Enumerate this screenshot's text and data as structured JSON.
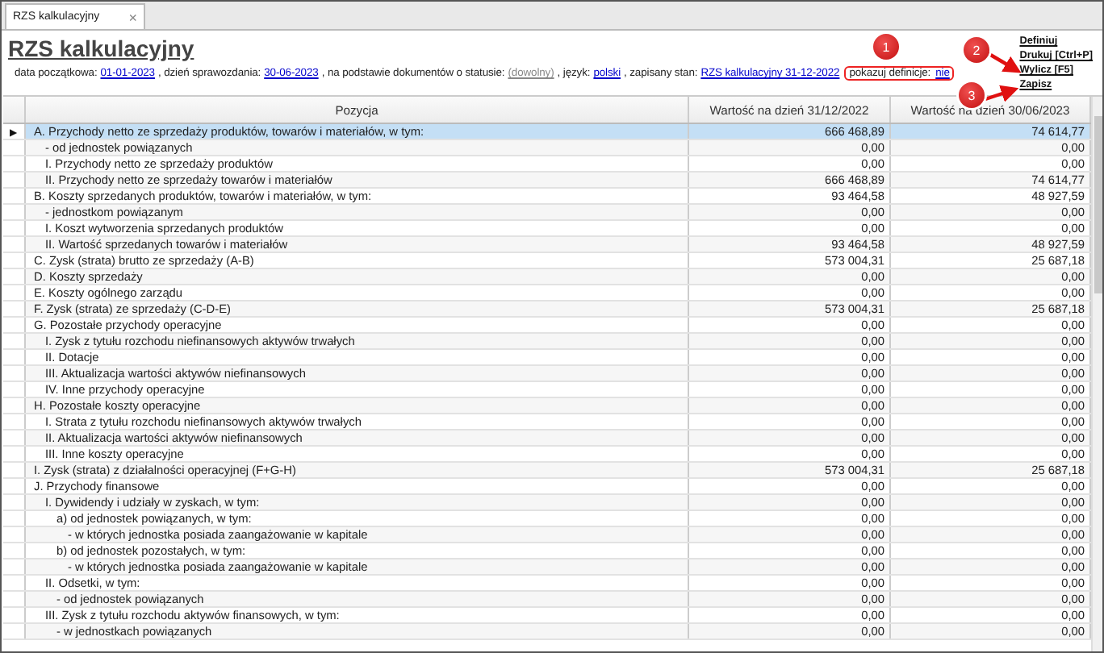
{
  "tab": {
    "label": "RZS kalkulacyjny",
    "close": "×"
  },
  "title": "RZS kalkulacyjny",
  "info": [
    {
      "kind": "label",
      "text": "data początkowa:"
    },
    {
      "kind": "link",
      "text": "01-01-2023"
    },
    {
      "kind": "label",
      "text": ", dzień sprawozdania:"
    },
    {
      "kind": "link",
      "text": "30-06-2023"
    },
    {
      "kind": "label",
      "text": ", na podstawie dokumentów o statusie:"
    },
    {
      "kind": "muted_link",
      "text": "(dowolny)"
    },
    {
      "kind": "label",
      "text": ", język:"
    },
    {
      "kind": "link",
      "text": "polski"
    },
    {
      "kind": "label",
      "text": ", zapisany stan:"
    },
    {
      "kind": "link",
      "text": "RZS kalkulacyjny 31-12-2022"
    }
  ],
  "highlighted_setting": {
    "label": "pokazuj definicje:",
    "value": "nie"
  },
  "actions": [
    "Definiuj",
    "Drukuj [Ctrl+P]",
    "Wylicz [F5]",
    "Zapisz"
  ],
  "callouts": [
    {
      "number": "1"
    },
    {
      "number": "2"
    },
    {
      "number": "3"
    }
  ],
  "table": {
    "selected_marker": "▶",
    "columns": [
      "Pozycja",
      "Wartość na dzień 31/12/2022",
      "Wartość na dzień 30/06/2023"
    ],
    "rows": [
      {
        "label": "A. Przychody netto ze sprzedaży produktów, towarów i materiałów, w tym:",
        "values": [
          "666 468,89",
          "74 614,77"
        ],
        "selected": true,
        "children": [
          {
            "label": "- od jednostek powiązanych",
            "values": [
              "0,00",
              "0,00"
            ],
            "selected": false
          },
          {
            "label": "I. Przychody netto ze sprzedaży produktów",
            "values": [
              "0,00",
              "0,00"
            ],
            "selected": false
          },
          {
            "label": "II. Przychody netto ze sprzedaży towarów i materiałów",
            "values": [
              "666 468,89",
              "74 614,77"
            ],
            "selected": false
          }
        ]
      },
      {
        "label": "B. Koszty sprzedanych produktów, towarów i materiałów, w tym:",
        "values": [
          "93 464,58",
          "48 927,59"
        ],
        "selected": false,
        "children": [
          {
            "label": "- jednostkom powiązanym",
            "values": [
              "0,00",
              "0,00"
            ],
            "selected": false
          },
          {
            "label": "I. Koszt wytworzenia sprzedanych produktów",
            "values": [
              "0,00",
              "0,00"
            ],
            "selected": false
          },
          {
            "label": "II. Wartość sprzedanych towarów i materiałów",
            "values": [
              "93 464,58",
              "48 927,59"
            ],
            "selected": false
          }
        ]
      },
      {
        "label": "C. Zysk (strata) brutto ze sprzedaży (A-B)",
        "values": [
          "573 004,31",
          "25 687,18"
        ],
        "selected": false
      },
      {
        "label": "D. Koszty sprzedaży",
        "values": [
          "0,00",
          "0,00"
        ],
        "selected": false
      },
      {
        "label": "E. Koszty ogólnego zarządu",
        "values": [
          "0,00",
          "0,00"
        ],
        "selected": false
      },
      {
        "label": "F. Zysk (strata) ze sprzedaży (C-D-E)",
        "values": [
          "573 004,31",
          "25 687,18"
        ],
        "selected": false
      },
      {
        "label": "G. Pozostałe przychody operacyjne",
        "values": [
          "0,00",
          "0,00"
        ],
        "selected": false,
        "children": [
          {
            "label": "I. Zysk z tytułu rozchodu niefinansowych aktywów trwałych",
            "values": [
              "0,00",
              "0,00"
            ],
            "selected": false
          },
          {
            "label": "II. Dotacje",
            "values": [
              "0,00",
              "0,00"
            ],
            "selected": false
          },
          {
            "label": "III. Aktualizacja wartości aktywów niefinansowych",
            "values": [
              "0,00",
              "0,00"
            ],
            "selected": false
          },
          {
            "label": "IV. Inne przychody operacyjne",
            "values": [
              "0,00",
              "0,00"
            ],
            "selected": false
          }
        ]
      },
      {
        "label": "H. Pozostałe koszty operacyjne",
        "values": [
          "0,00",
          "0,00"
        ],
        "selected": false,
        "children": [
          {
            "label": "I. Strata z tytułu rozchodu niefinansowych aktywów trwałych",
            "values": [
              "0,00",
              "0,00"
            ],
            "selected": false
          },
          {
            "label": "II. Aktualizacja wartości aktywów niefinansowych",
            "values": [
              "0,00",
              "0,00"
            ],
            "selected": false
          },
          {
            "label": "III. Inne koszty operacyjne",
            "values": [
              "0,00",
              "0,00"
            ],
            "selected": false
          }
        ]
      },
      {
        "label": "I. Zysk (strata) z działalności operacyjnej (F+G-H)",
        "values": [
          "573 004,31",
          "25 687,18"
        ],
        "selected": false
      },
      {
        "label": "J. Przychody finansowe",
        "values": [
          "0,00",
          "0,00"
        ],
        "selected": false,
        "children": [
          {
            "label": "I. Dywidendy i udziały w zyskach, w tym:",
            "values": [
              "0,00",
              "0,00"
            ],
            "selected": false,
            "children": [
              {
                "label": "a) od jednostek powiązanych, w tym:",
                "values": [
                  "0,00",
                  "0,00"
                ],
                "selected": false,
                "children": [
                  {
                    "label": "- w których jednostka posiada zaangażowanie w kapitale",
                    "values": [
                      "0,00",
                      "0,00"
                    ],
                    "selected": false
                  }
                ]
              },
              {
                "label": "b) od jednostek pozostałych, w tym:",
                "values": [
                  "0,00",
                  "0,00"
                ],
                "selected": false,
                "children": [
                  {
                    "label": "- w których jednostka posiada zaangażowanie w kapitale",
                    "values": [
                      "0,00",
                      "0,00"
                    ],
                    "selected": false
                  }
                ]
              }
            ]
          },
          {
            "label": "II. Odsetki, w tym:",
            "values": [
              "0,00",
              "0,00"
            ],
            "selected": false,
            "children": [
              {
                "label": "- od jednostek powiązanych",
                "values": [
                  "0,00",
                  "0,00"
                ],
                "selected": false
              }
            ]
          },
          {
            "label": "III. Zysk z tytułu rozchodu aktywów finansowych, w tym:",
            "values": [
              "0,00",
              "0,00"
            ],
            "selected": false,
            "children": [
              {
                "label": "- w jednostkach powiązanych",
                "values": [
                  "0,00",
                  "0,00"
                ],
                "selected": false
              }
            ]
          }
        ]
      }
    ]
  }
}
